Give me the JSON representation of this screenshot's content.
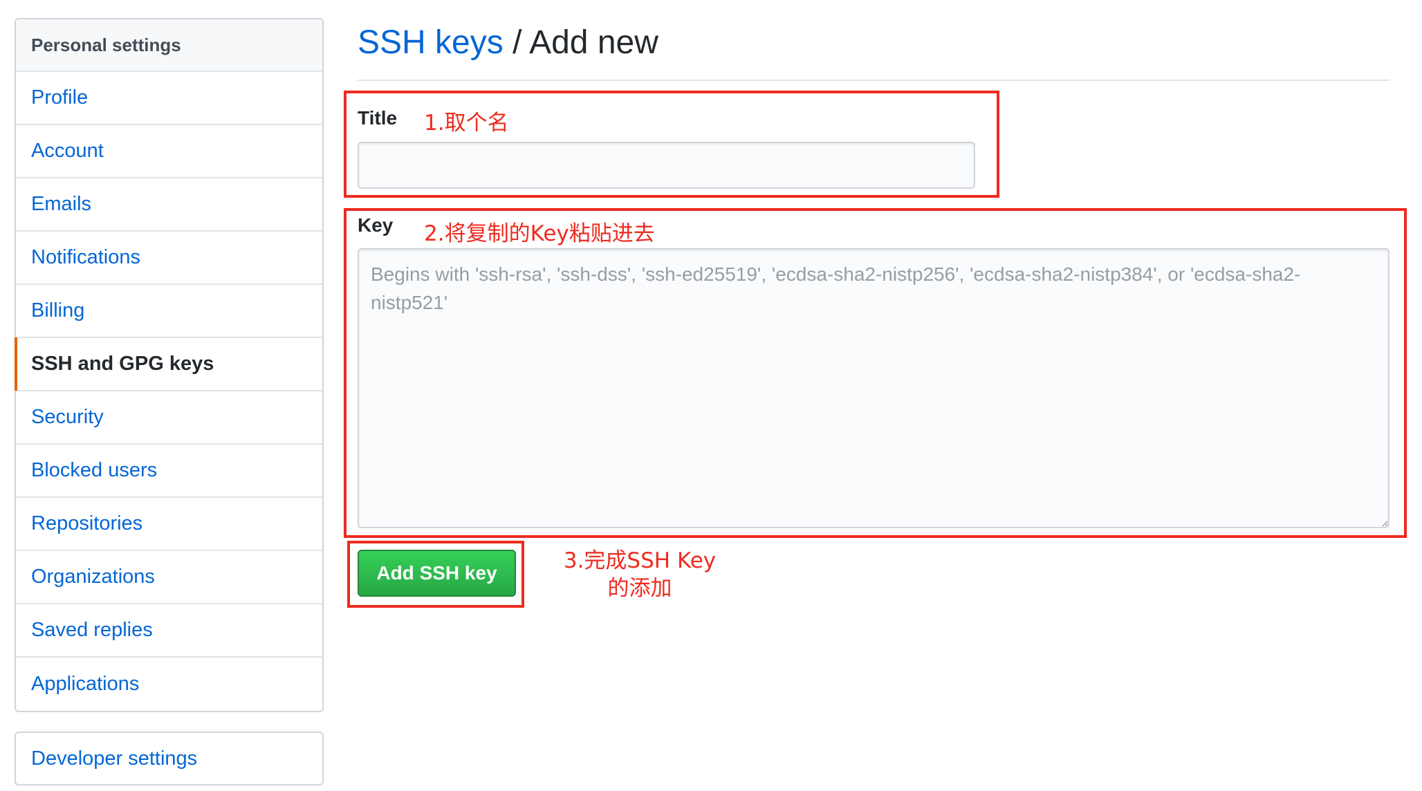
{
  "sidebar": {
    "header": "Personal settings",
    "items": [
      {
        "label": "Profile"
      },
      {
        "label": "Account"
      },
      {
        "label": "Emails"
      },
      {
        "label": "Notifications"
      },
      {
        "label": "Billing"
      },
      {
        "label": "SSH and GPG keys"
      },
      {
        "label": "Security"
      },
      {
        "label": "Blocked users"
      },
      {
        "label": "Repositories"
      },
      {
        "label": "Organizations"
      },
      {
        "label": "Saved replies"
      },
      {
        "label": "Applications"
      }
    ],
    "selected": "SSH and GPG keys",
    "developer_settings": "Developer settings"
  },
  "heading": {
    "crumb": "SSH keys",
    "separator": " / ",
    "title": "Add new"
  },
  "form": {
    "title_label": "Title",
    "title_value": "",
    "key_label": "Key",
    "key_placeholder": "Begins with 'ssh-rsa', 'ssh-dss', 'ssh-ed25519', 'ecdsa-sha2-nistp256', 'ecdsa-sha2-nistp384', or 'ecdsa-sha2-nistp521'",
    "submit_label": "Add SSH key"
  },
  "annotations": {
    "note1": "1.取个名",
    "note2": "2.将复制的Key粘贴进去",
    "note3_line1": "3.完成SSH Key",
    "note3_line2": "的添加"
  },
  "colors": {
    "link": "#0366d6",
    "selected_marker": "#e36209",
    "button_green": "#28a745",
    "annotation_red": "#ee2b1f"
  }
}
